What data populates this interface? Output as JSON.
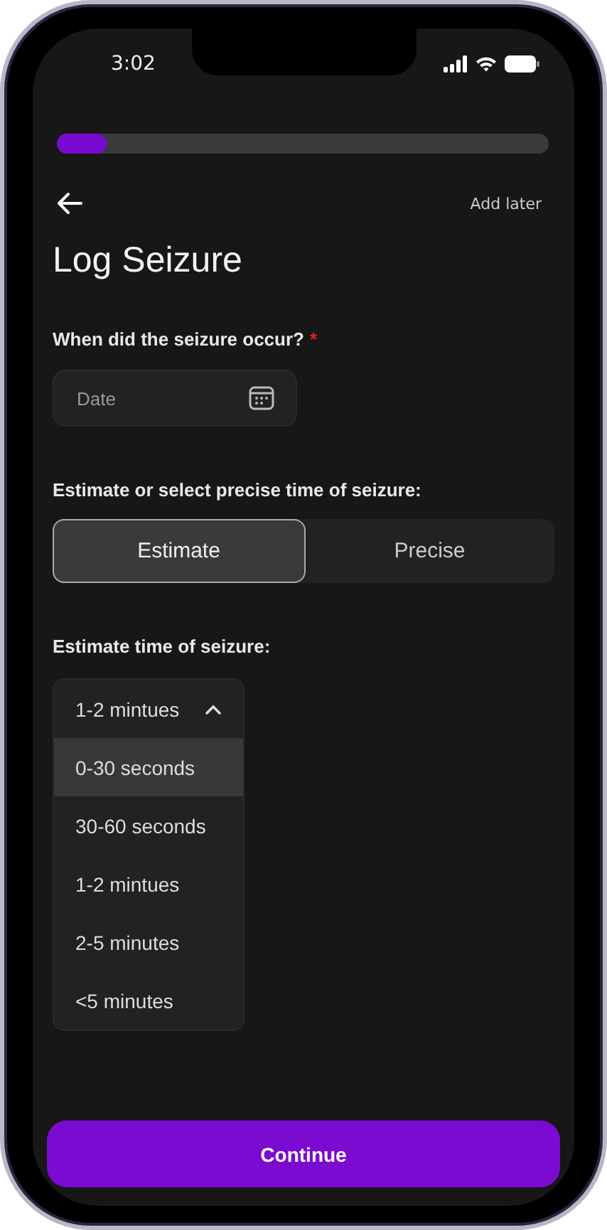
{
  "status_bar": {
    "time": "3:02"
  },
  "progress": {
    "level": 0.1
  },
  "nav": {
    "action": "Add later"
  },
  "title": "Log Seizure",
  "date_question": {
    "label": "When did the seizure occur?",
    "required_mark": "*",
    "placeholder": "Date"
  },
  "time_mode": {
    "label": "Estimate or select precise time of seizure:",
    "options": [
      {
        "label": "Estimate",
        "selected": true
      },
      {
        "label": "Precise",
        "selected": false
      }
    ]
  },
  "estimate": {
    "label": "Estimate time of seizure:",
    "value": "1-2 mintues",
    "expanded": true,
    "options": [
      {
        "label": "0-30 seconds",
        "highlighted": true
      },
      {
        "label": "30-60 seconds",
        "highlighted": false
      },
      {
        "label": "1-2 mintues",
        "highlighted": false
      },
      {
        "label": "2-5 minutes",
        "highlighted": false
      },
      {
        "label": "<5 minutes",
        "highlighted": false
      }
    ]
  },
  "primary_button": "Continue"
}
